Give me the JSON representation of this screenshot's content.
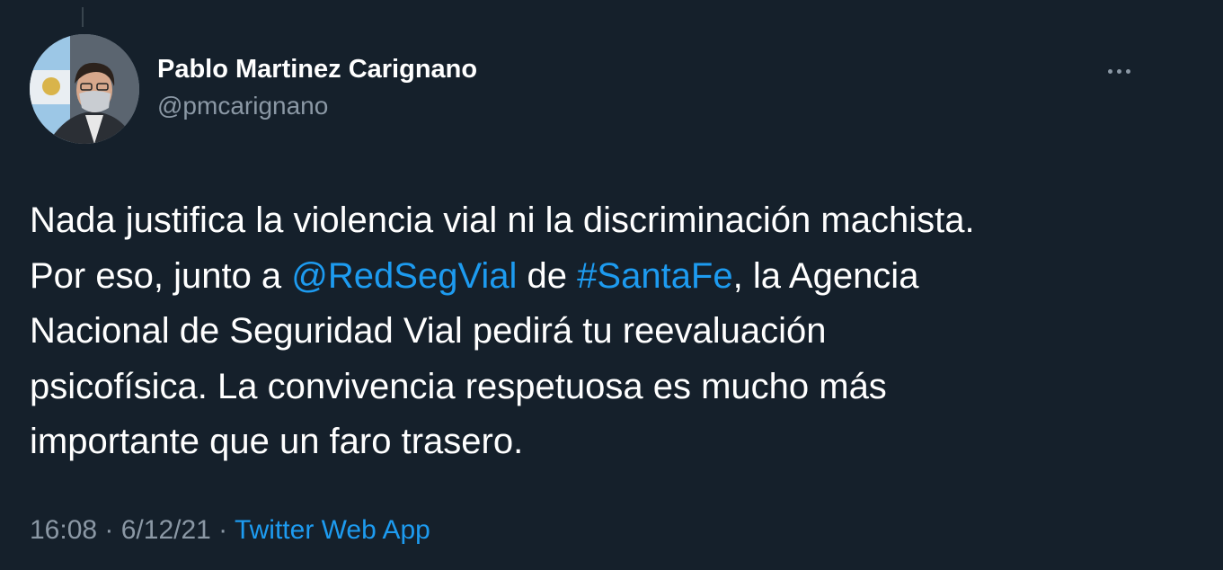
{
  "author": {
    "display_name": "Pablo Martinez Carignano",
    "handle": "@pmcarignano"
  },
  "more_icon": "more-horizontal-icon",
  "tweet": {
    "line1": "Nada justifica la violencia vial ni la discriminación machista.",
    "line2_prefix": "Por eso, junto a ",
    "mention": "@RedSegVial",
    "line2_mid": " de ",
    "hashtag": "#SantaFe",
    "line2_suffix": ", la Agencia",
    "line3": "Nacional de Seguridad Vial pedirá tu reevaluación",
    "line4": "psicofísica. La convivencia respetuosa es mucho más",
    "line5": "importante que un faro trasero."
  },
  "meta": {
    "time": "16:08",
    "separator": " · ",
    "date": "6/12/21",
    "source": "Twitter Web App"
  },
  "colors": {
    "background": "#15202b",
    "text": "#ffffff",
    "secondary": "#8b98a5",
    "link": "#1d9bf0"
  }
}
